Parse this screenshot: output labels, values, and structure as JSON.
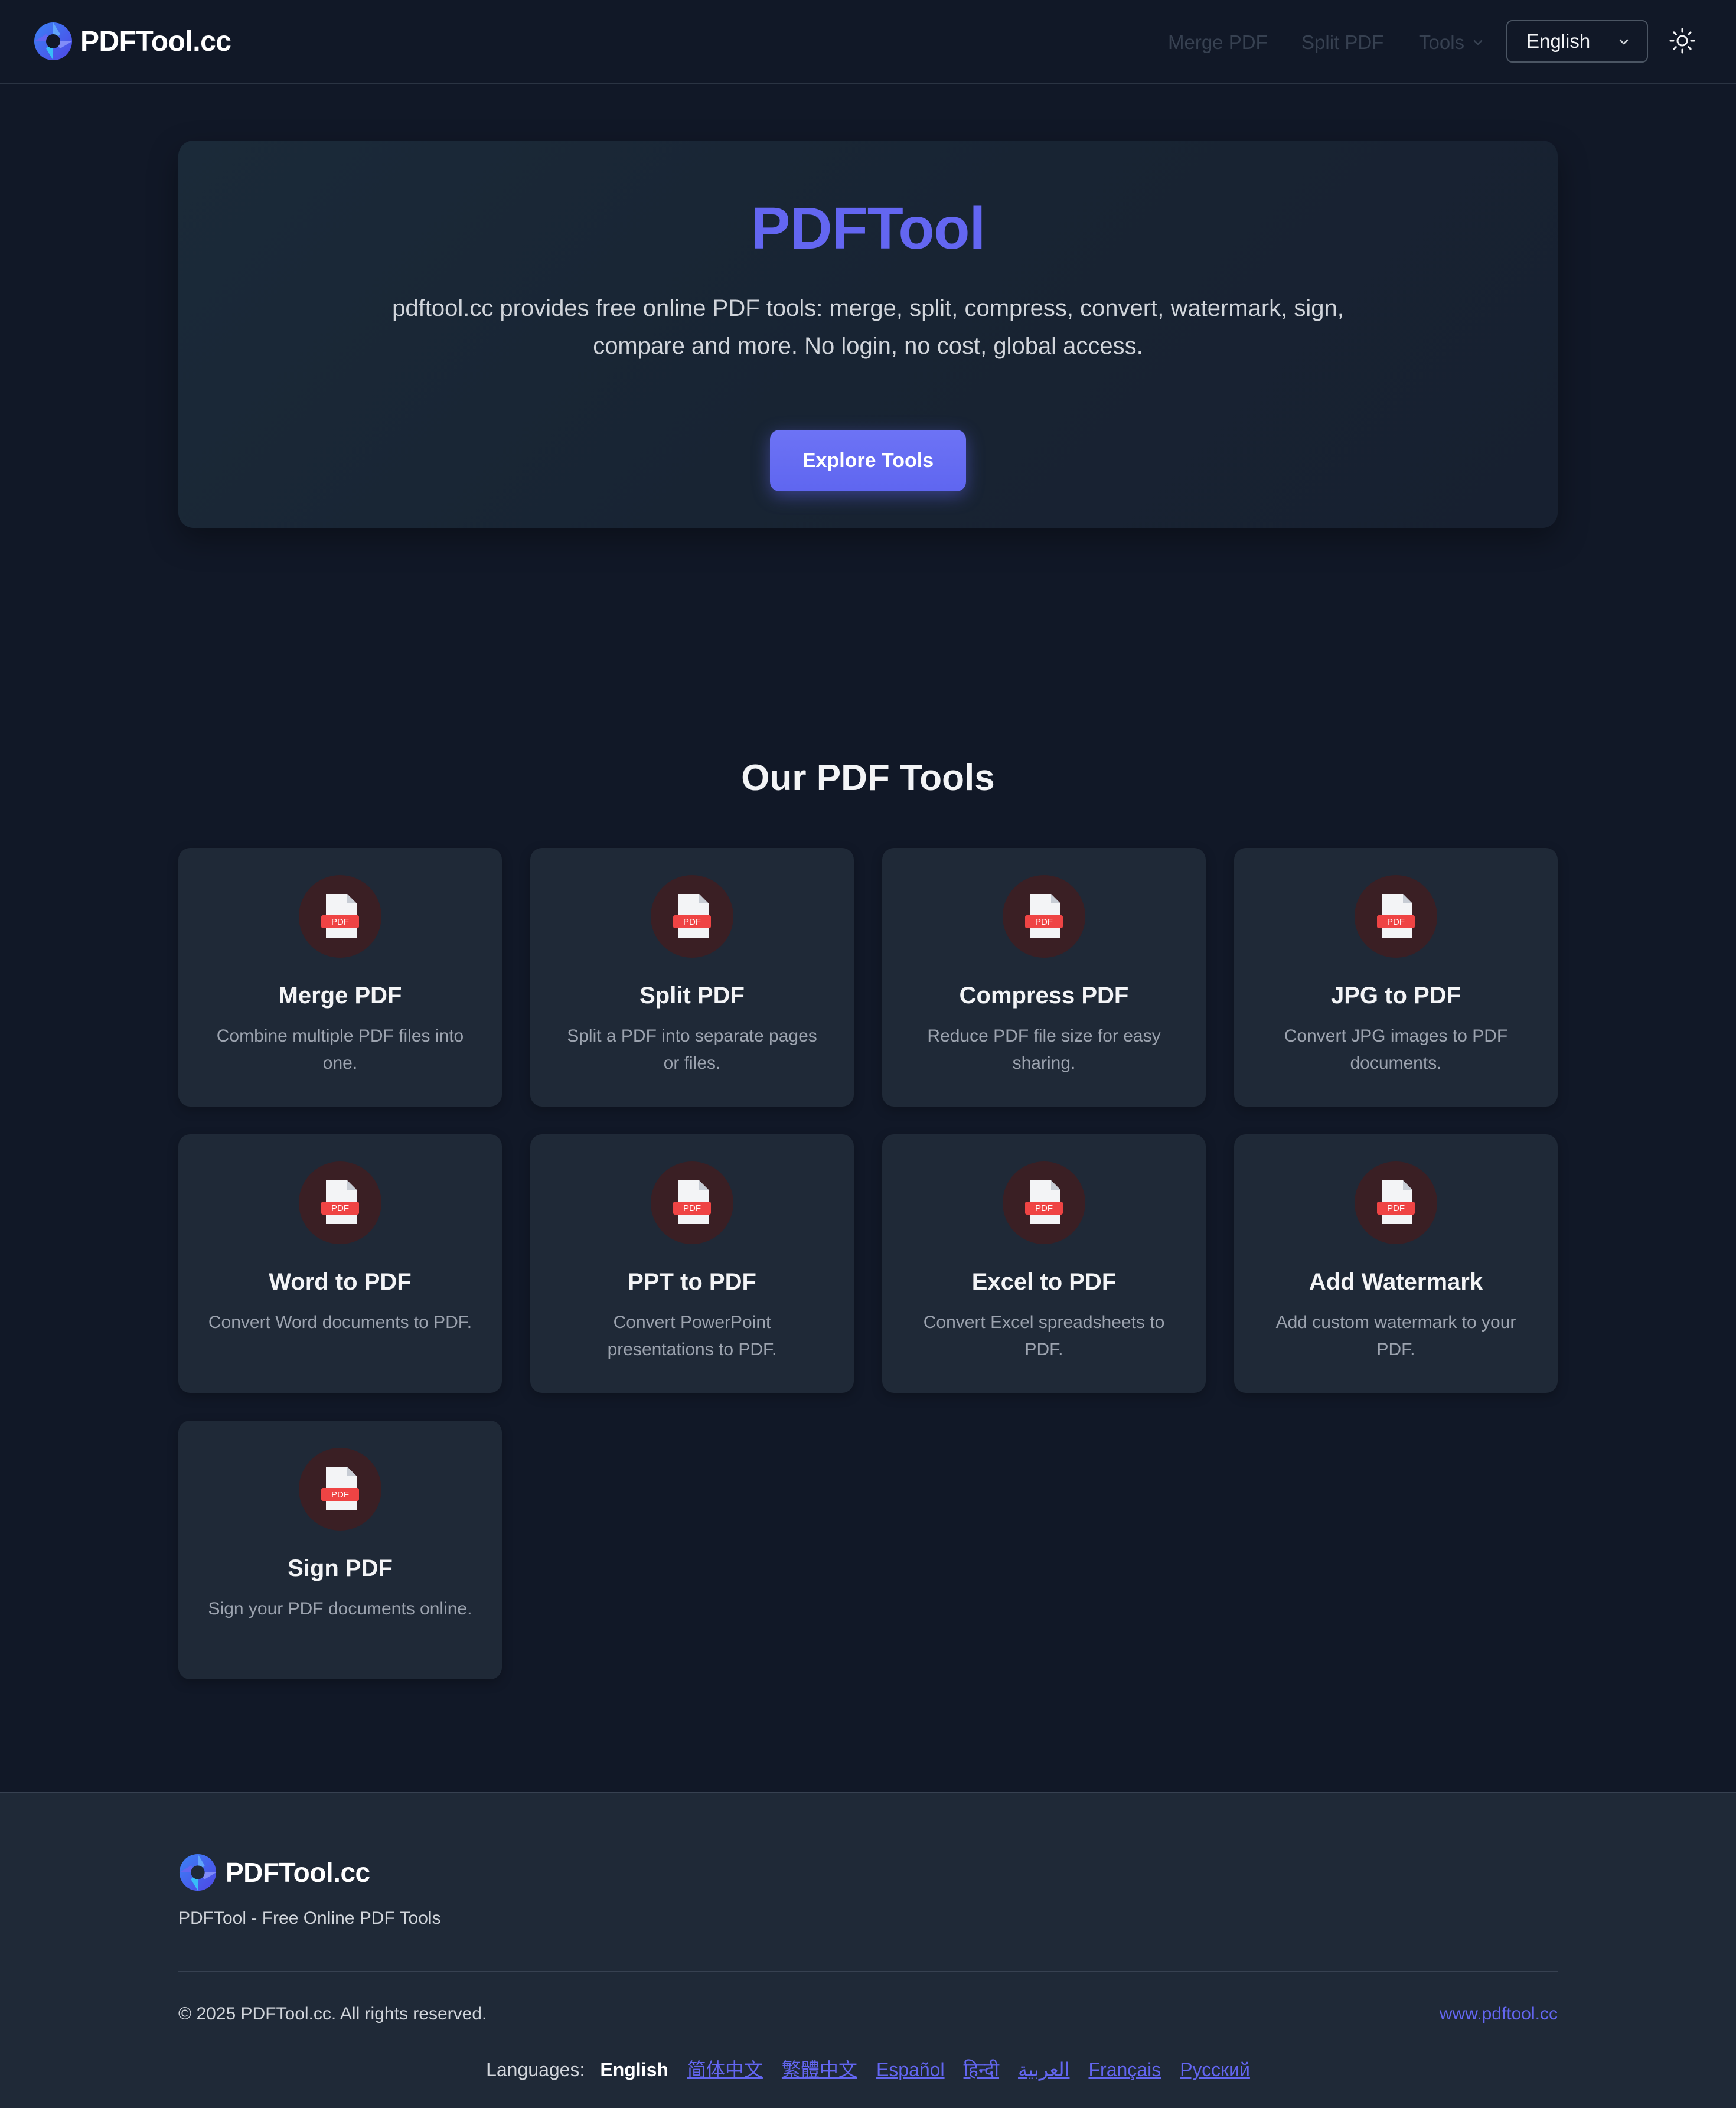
{
  "header": {
    "brand": "PDFTool.cc",
    "nav": {
      "merge": "Merge PDF",
      "split": "Split PDF",
      "tools": "Tools"
    },
    "language": "English"
  },
  "hero": {
    "title": "PDFTool",
    "description": "pdftool.cc provides free online PDF tools: merge, split, compress, convert, watermark, sign, compare and more. No login, no cost, global access.",
    "cta": "Explore Tools"
  },
  "tools": {
    "title": "Our PDF Tools",
    "icon_label": "PDF",
    "items": [
      {
        "name": "Merge PDF",
        "desc": "Combine multiple PDF files into one."
      },
      {
        "name": "Split PDF",
        "desc": "Split a PDF into separate pages or files."
      },
      {
        "name": "Compress PDF",
        "desc": "Reduce PDF file size for easy sharing."
      },
      {
        "name": "JPG to PDF",
        "desc": "Convert JPG images to PDF documents."
      },
      {
        "name": "Word to PDF",
        "desc": "Convert Word documents to PDF."
      },
      {
        "name": "PPT to PDF",
        "desc": "Convert PowerPoint presentations to PDF."
      },
      {
        "name": "Excel to PDF",
        "desc": "Convert Excel spreadsheets to PDF."
      },
      {
        "name": "Add Watermark",
        "desc": "Add custom watermark to your PDF."
      },
      {
        "name": "Sign PDF",
        "desc": "Sign your PDF documents online."
      }
    ]
  },
  "footer": {
    "brand": "PDFTool.cc",
    "tagline": "PDFTool - Free Online PDF Tools",
    "copyright": "© 2025 PDFTool.cc. All rights reserved.",
    "site": "www.pdftool.cc",
    "languages_label": "Languages:",
    "current_language": "English",
    "languages": [
      "简体中文",
      "繁體中文",
      "Español",
      "हिन्दी",
      "العربية",
      "Français",
      "Русский"
    ]
  },
  "colors": {
    "background": "#111827",
    "card": "#1f2937",
    "accent": "#6366f1",
    "pdf_red": "#ef4444"
  },
  "icons": {
    "logo": "aperture-logo-icon",
    "tool": "pdf-file-icon",
    "theme": "sun-icon",
    "dropdown": "chevron-down-icon"
  }
}
